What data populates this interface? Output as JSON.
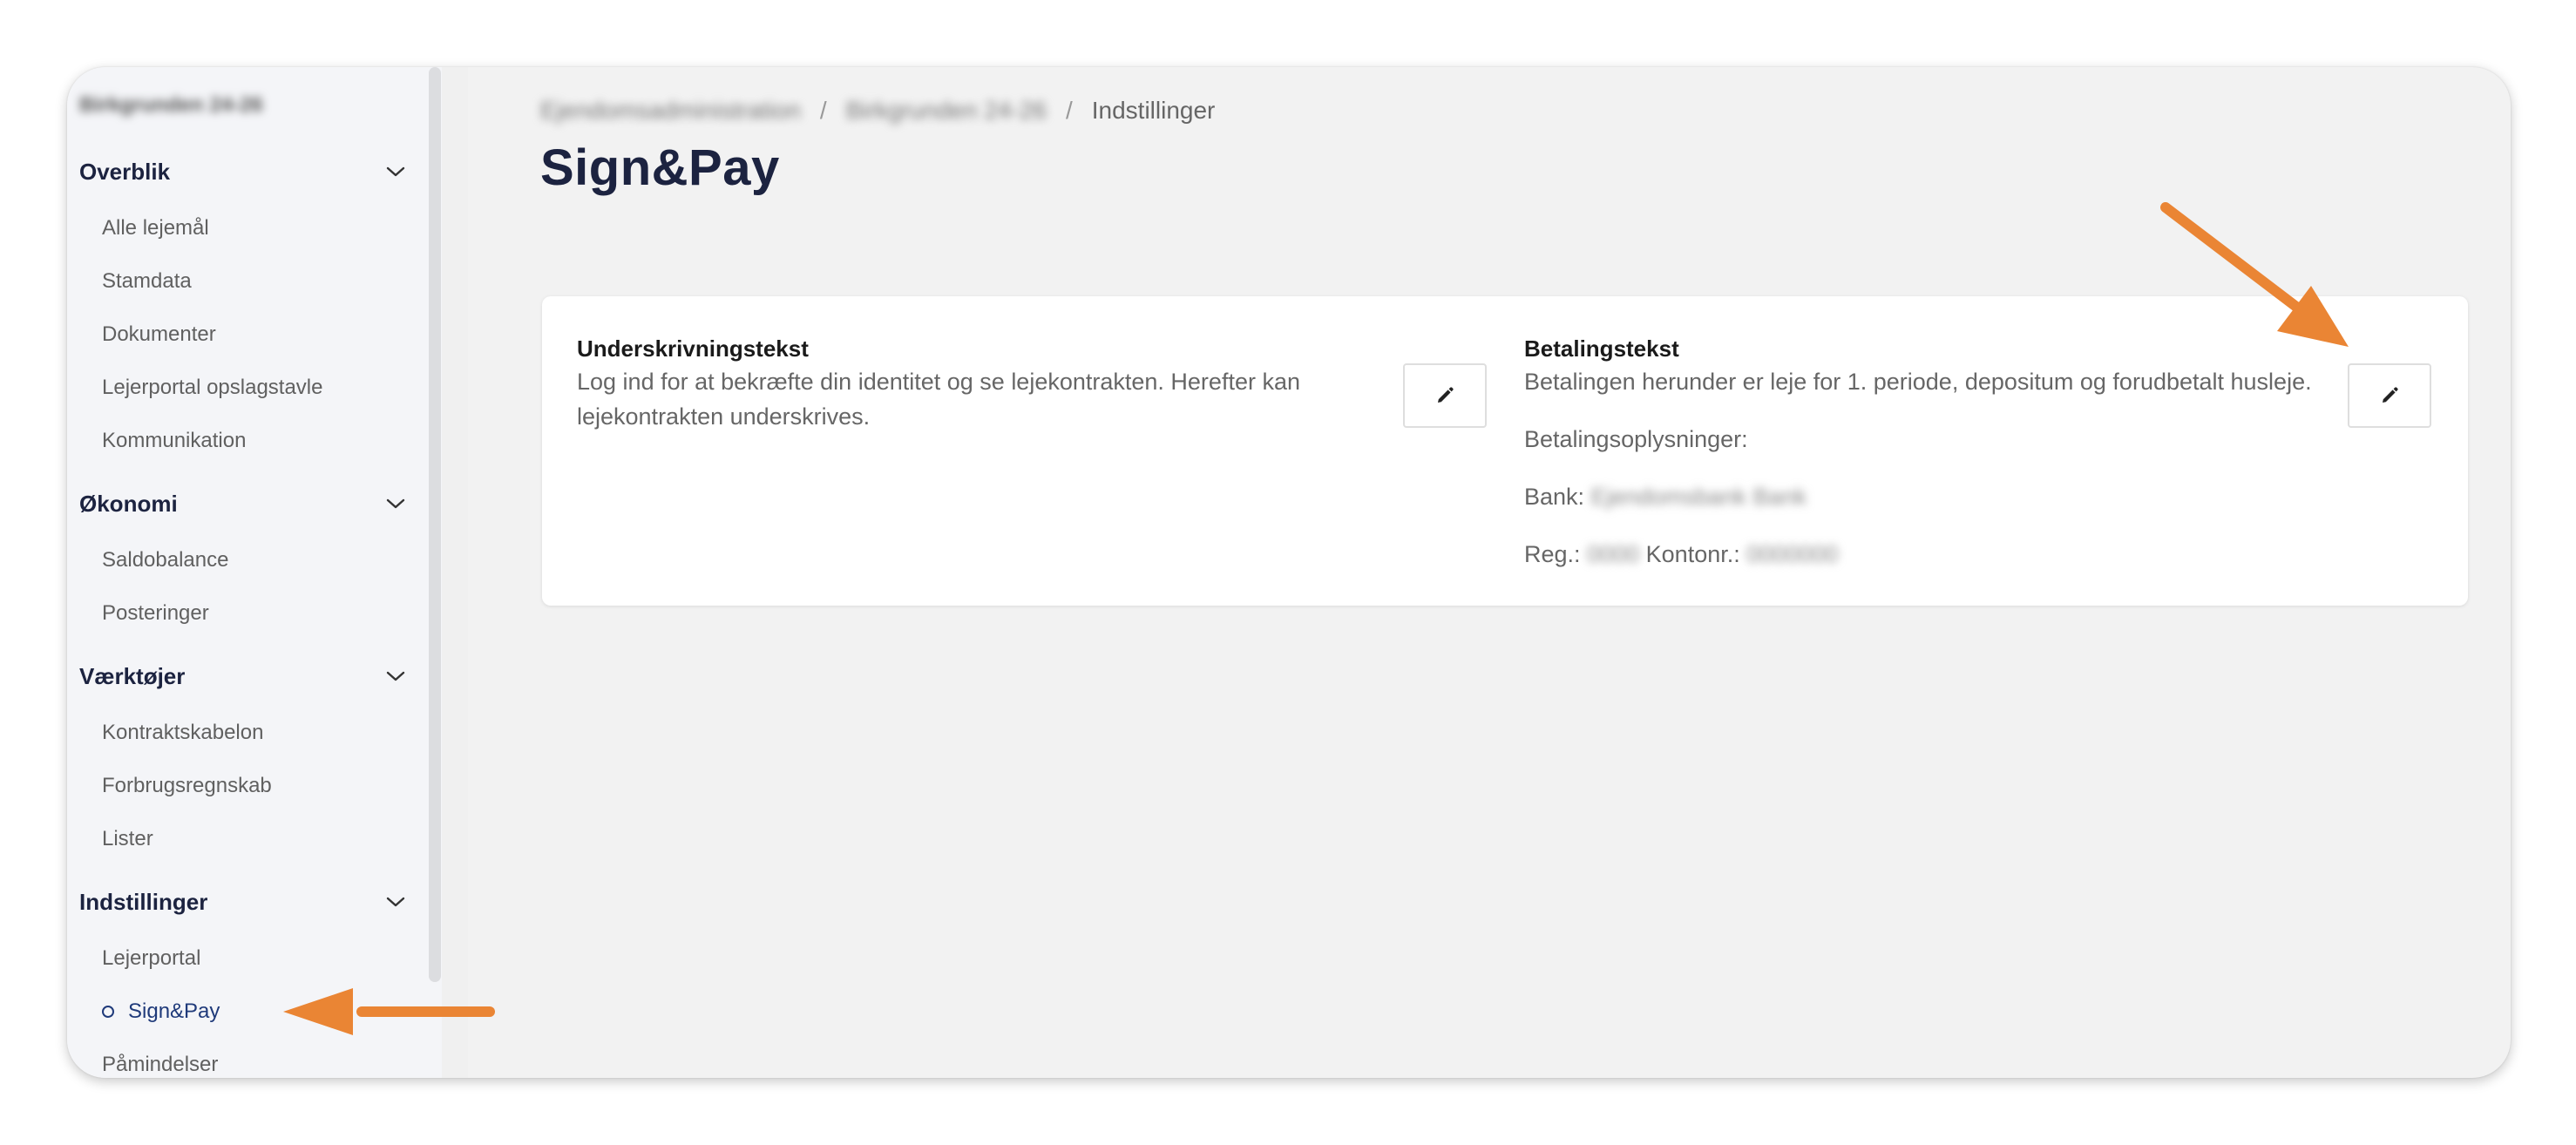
{
  "sidebar": {
    "property_name": "Birkgrunden 24-26",
    "sections": [
      {
        "title": "Overblik",
        "items": [
          "Alle lejemål",
          "Stamdata",
          "Dokumenter",
          "Lejerportal opslagstavle",
          "Kommunikation"
        ]
      },
      {
        "title": "Økonomi",
        "items": [
          "Saldobalance",
          "Posteringer"
        ]
      },
      {
        "title": "Værktøjer",
        "items": [
          "Kontraktskabelon",
          "Forbrugsregnskab",
          "Lister"
        ]
      },
      {
        "title": "Indstillinger",
        "items": [
          "Lejerportal",
          "Sign&Pay",
          "Påmindelser"
        ]
      }
    ],
    "active_item": "Sign&Pay"
  },
  "breadcrumb": {
    "crumb1": "Ejendomsadministration",
    "crumb2": "Birkgrunden 24-26",
    "current": "Indstillinger",
    "separator": "/"
  },
  "page": {
    "title": "Sign&Pay"
  },
  "signing": {
    "title": "Underskrivningstekst",
    "text": "Log ind for at bekræfte din identitet og se lejekontrakten. Herefter kan lejekontrakten underskrives."
  },
  "payment": {
    "title": "Betalingstekst",
    "text": "Betalingen herunder er leje for 1. periode, depositum og forudbetalt husleje.",
    "info_label": "Betalingsoplysninger:",
    "bank_label": "Bank:",
    "bank_value": "Ejendomsbank Bank",
    "reg_label": "Reg.:",
    "reg_value": "0000",
    "account_label": "Kontonr.:",
    "account_value": "0000000"
  },
  "colors": {
    "accent_arrow": "#ea8534",
    "title": "#1c2340",
    "active": "#1f3a7a"
  },
  "icons": {
    "chevron": "chevron-down-icon",
    "edit": "pencil-icon",
    "active": "circle-outline-icon"
  }
}
